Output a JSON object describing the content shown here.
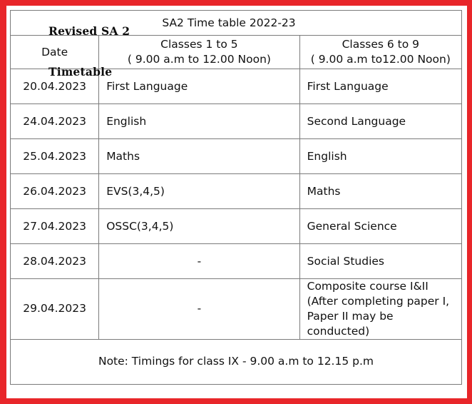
{
  "overlay": {
    "line1": "Revised SA 2",
    "line2": "Timetable"
  },
  "table": {
    "title": "SA2 Time table 2022-23",
    "headers": {
      "date": "Date",
      "classes_1_5_line1": "Classes 1 to 5",
      "classes_1_5_line2": "( 9.00 a.m to 12.00 Noon)",
      "classes_6_9_line1": "Classes 6 to 9",
      "classes_6_9_line2": "( 9.00 a.m to12.00 Noon)"
    },
    "rows": [
      {
        "date": "20.04.2023",
        "classes_1_5": "First Language",
        "classes_6_9": "First Language"
      },
      {
        "date": "24.04.2023",
        "classes_1_5": "English",
        "classes_6_9": "Second Language"
      },
      {
        "date": "25.04.2023",
        "classes_1_5": "Maths",
        "classes_6_9": "English"
      },
      {
        "date": "26.04.2023",
        "classes_1_5": "EVS(3,4,5)",
        "classes_6_9": "Maths"
      },
      {
        "date": "27.04.2023",
        "classes_1_5": "OSSC(3,4,5)",
        "classes_6_9": "General Science"
      },
      {
        "date": "28.04.2023",
        "classes_1_5": "-",
        "classes_6_9": "Social Studies"
      },
      {
        "date": "29.04.2023",
        "classes_1_5": "-",
        "classes_6_9_line1": "Composite course I&II",
        "classes_6_9_line2": "(After completing paper I,",
        "classes_6_9_line3": "Paper II may be",
        "classes_6_9_line4": "conducted)"
      }
    ],
    "note": "Note: Timings for class IX  - 9.00 a.m to 12.15 p.m"
  },
  "colors": {
    "frame_red": "#e8262a",
    "grid_gray": "#7b7b7b",
    "text": "#111111"
  }
}
